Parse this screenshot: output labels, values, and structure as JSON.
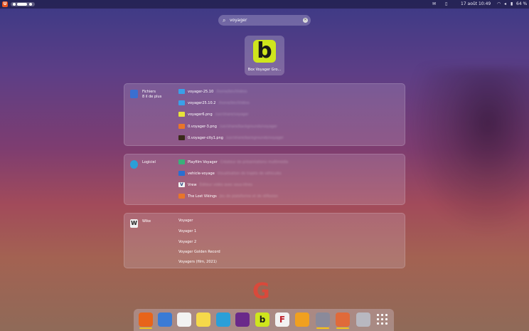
{
  "topbar": {
    "date_time": "17 août  10:49",
    "battery": "64 %",
    "icons": [
      "ubuntu-logo",
      "workspace-indicator",
      "mail-icon",
      "clipboard-icon",
      "wifi-icon",
      "volume-icon",
      "battery-icon"
    ]
  },
  "search": {
    "value": "voyager",
    "icon": "search-icon",
    "clear_icon": "clear-icon"
  },
  "app_result": {
    "label": "Box Voyager Gro...",
    "icon": "box-icon",
    "color": "#cfe61c"
  },
  "files_panel": {
    "title": "Fichiers",
    "subtitle": "8 il de plus",
    "icon": "files-icon",
    "rows": [
      {
        "name": "voyager-25.10",
        "path": "/home/bin/Vidéos",
        "icon": "folder-icon"
      },
      {
        "name": "voyager25.10.2",
        "path": "/home/bin/Vidéos",
        "icon": "folder-icon"
      },
      {
        "name": "voyager6.png",
        "path": "/usr/share/voyager",
        "icon": "image-icon"
      },
      {
        "name": "0.voyager-3.png",
        "path": "/usr/share/backgrounds/voyager",
        "icon": "image-icon"
      },
      {
        "name": "0.voyager-city1.png",
        "path": "/usr/share/backgrounds/voyager",
        "icon": "image-icon"
      }
    ]
  },
  "software_panel": {
    "title": "Logiciel",
    "icon": "software-icon",
    "rows": [
      {
        "name": "Playfilm Voyager",
        "desc": "Créateur de présentations multimédia",
        "icon": "app-icon"
      },
      {
        "name": "vehicle-voyage",
        "desc": "Visualisation de trajets de véhicules",
        "icon": "app-icon"
      },
      {
        "name": "Vrew",
        "desc": "Éditeur vidéo avec sous-titres",
        "icon": "app-icon"
      },
      {
        "name": "The Lost Vikings",
        "desc": "Jeu de plateforme et de réflexion",
        "icon": "app-icon"
      }
    ]
  },
  "wiki_panel": {
    "title": "Wike",
    "icon": "wikipedia-icon",
    "rows": [
      "Voyager",
      "Voyager 1",
      "Voyager 2",
      "Voyager Golden Record",
      "Voyagers (film, 2021)"
    ]
  },
  "google": {
    "icon": "google-icon",
    "letter": "G"
  },
  "dock": {
    "items": [
      {
        "name": "firefox-icon",
        "color": "#e8641a",
        "running": true,
        "glyph": ""
      },
      {
        "name": "notes-icon",
        "color": "#3a7bd5",
        "running": false,
        "glyph": ""
      },
      {
        "name": "document-icon",
        "color": "#f2f2f2",
        "running": false,
        "glyph": ""
      },
      {
        "name": "sticky-notes-icon",
        "color": "#f6d94a",
        "running": false,
        "glyph": ""
      },
      {
        "name": "software-store-icon",
        "color": "#2a9fd8",
        "running": false,
        "glyph": ""
      },
      {
        "name": "media-icon",
        "color": "#6a2a8a",
        "running": false,
        "glyph": ""
      },
      {
        "name": "box-icon",
        "color": "#cfe61c",
        "running": false,
        "glyph": "b"
      },
      {
        "name": "reader-icon",
        "color": "#f2f2f2",
        "running": false,
        "glyph": "F"
      },
      {
        "name": "radio-icon",
        "color": "#f0a020",
        "running": false,
        "glyph": ""
      },
      {
        "name": "tablet-icon",
        "color": "#8a8a9a",
        "running": true,
        "glyph": ""
      },
      {
        "name": "apps-icon",
        "color": "#e06a3a",
        "running": true,
        "glyph": ""
      },
      {
        "name": "trash-icon",
        "color": "#b8b8c0",
        "running": false,
        "glyph": ""
      }
    ],
    "app_grid": "app-grid-icon"
  }
}
